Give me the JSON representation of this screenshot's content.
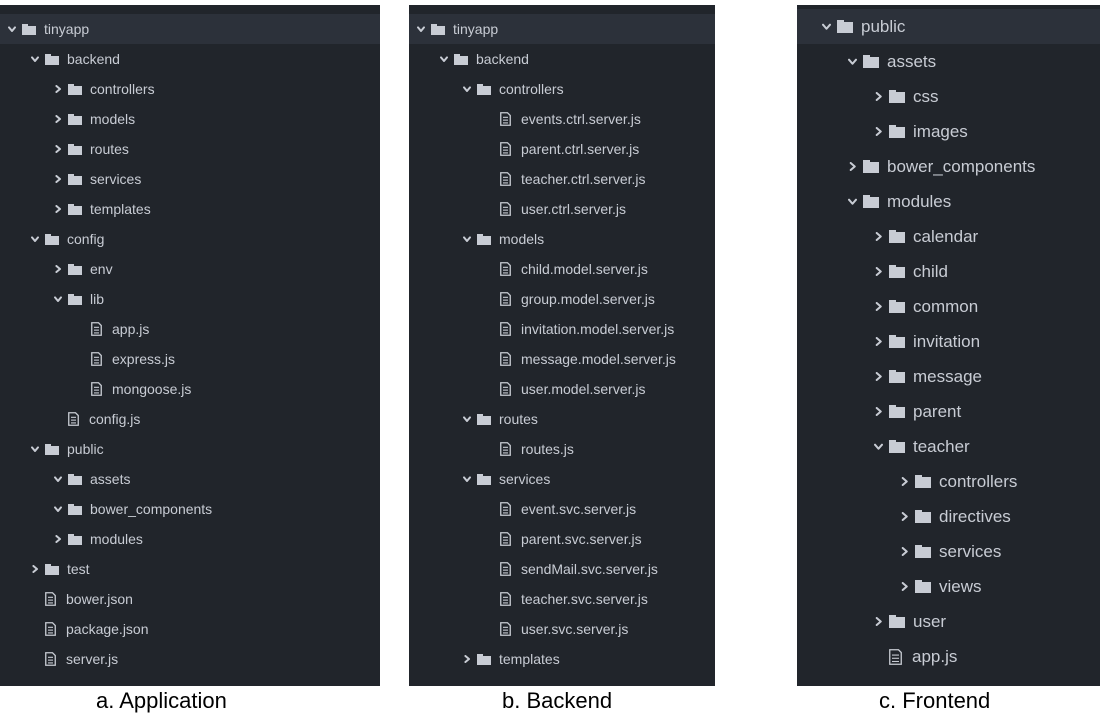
{
  "colors": {
    "panel_bg": "#21252b",
    "root_bg": "#2c313a",
    "text": "#c8ccd4"
  },
  "panels": [
    {
      "id": "a",
      "caption": "a.  Application",
      "items": [
        {
          "depth": 0,
          "type": "folder",
          "state": "open",
          "label": "tinyapp",
          "root": true
        },
        {
          "depth": 1,
          "type": "folder",
          "state": "open",
          "label": "backend"
        },
        {
          "depth": 2,
          "type": "folder",
          "state": "closed",
          "label": "controllers"
        },
        {
          "depth": 2,
          "type": "folder",
          "state": "closed",
          "label": "models"
        },
        {
          "depth": 2,
          "type": "folder",
          "state": "closed",
          "label": "routes"
        },
        {
          "depth": 2,
          "type": "folder",
          "state": "closed",
          "label": "services"
        },
        {
          "depth": 2,
          "type": "folder",
          "state": "closed",
          "label": "templates"
        },
        {
          "depth": 1,
          "type": "folder",
          "state": "open",
          "label": "config"
        },
        {
          "depth": 2,
          "type": "folder",
          "state": "closed",
          "label": "env"
        },
        {
          "depth": 2,
          "type": "folder",
          "state": "open",
          "label": "lib"
        },
        {
          "depth": 3,
          "type": "file",
          "label": "app.js"
        },
        {
          "depth": 3,
          "type": "file",
          "label": "express.js"
        },
        {
          "depth": 3,
          "type": "file",
          "label": "mongoose.js"
        },
        {
          "depth": 2,
          "type": "file",
          "label": "config.js"
        },
        {
          "depth": 1,
          "type": "folder",
          "state": "open",
          "label": "public"
        },
        {
          "depth": 2,
          "type": "folder",
          "state": "open",
          "label": "assets"
        },
        {
          "depth": 2,
          "type": "folder",
          "state": "open",
          "label": "bower_components"
        },
        {
          "depth": 2,
          "type": "folder",
          "state": "closed",
          "label": "modules"
        },
        {
          "depth": 1,
          "type": "folder",
          "state": "closed",
          "label": "test"
        },
        {
          "depth": 1,
          "type": "file",
          "label": "bower.json"
        },
        {
          "depth": 1,
          "type": "file",
          "label": "package.json"
        },
        {
          "depth": 1,
          "type": "file",
          "label": "server.js"
        }
      ]
    },
    {
      "id": "b",
      "caption": "b. Backend",
      "items": [
        {
          "depth": 0,
          "type": "folder",
          "state": "open",
          "label": "tinyapp",
          "root": true
        },
        {
          "depth": 1,
          "type": "folder",
          "state": "open",
          "label": "backend"
        },
        {
          "depth": 2,
          "type": "folder",
          "state": "open",
          "label": "controllers"
        },
        {
          "depth": 3,
          "type": "file",
          "label": "events.ctrl.server.js"
        },
        {
          "depth": 3,
          "type": "file",
          "label": "parent.ctrl.server.js"
        },
        {
          "depth": 3,
          "type": "file",
          "label": "teacher.ctrl.server.js"
        },
        {
          "depth": 3,
          "type": "file",
          "label": "user.ctrl.server.js"
        },
        {
          "depth": 2,
          "type": "folder",
          "state": "open",
          "label": "models"
        },
        {
          "depth": 3,
          "type": "file",
          "label": "child.model.server.js"
        },
        {
          "depth": 3,
          "type": "file",
          "label": "group.model.server.js"
        },
        {
          "depth": 3,
          "type": "file",
          "label": "invitation.model.server.js"
        },
        {
          "depth": 3,
          "type": "file",
          "label": "message.model.server.js"
        },
        {
          "depth": 3,
          "type": "file",
          "label": "user.model.server.js"
        },
        {
          "depth": 2,
          "type": "folder",
          "state": "open",
          "label": "routes"
        },
        {
          "depth": 3,
          "type": "file",
          "label": "routes.js"
        },
        {
          "depth": 2,
          "type": "folder",
          "state": "open",
          "label": "services"
        },
        {
          "depth": 3,
          "type": "file",
          "label": "event.svc.server.js"
        },
        {
          "depth": 3,
          "type": "file",
          "label": "parent.svc.server.js"
        },
        {
          "depth": 3,
          "type": "file",
          "label": "sendMail.svc.server.js"
        },
        {
          "depth": 3,
          "type": "file",
          "label": "teacher.svc.server.js"
        },
        {
          "depth": 3,
          "type": "file",
          "label": "user.svc.server.js"
        },
        {
          "depth": 2,
          "type": "folder",
          "state": "closed",
          "label": "templates"
        }
      ]
    },
    {
      "id": "c",
      "caption": "c. Frontend",
      "items": [
        {
          "depth": 0,
          "type": "folder",
          "state": "open",
          "label": "public",
          "root": true
        },
        {
          "depth": 1,
          "type": "folder",
          "state": "open",
          "label": "assets"
        },
        {
          "depth": 2,
          "type": "folder",
          "state": "closed",
          "label": "css"
        },
        {
          "depth": 2,
          "type": "folder",
          "state": "closed",
          "label": "images"
        },
        {
          "depth": 1,
          "type": "folder",
          "state": "closed",
          "label": "bower_components"
        },
        {
          "depth": 1,
          "type": "folder",
          "state": "open",
          "label": "modules"
        },
        {
          "depth": 2,
          "type": "folder",
          "state": "closed",
          "label": "calendar"
        },
        {
          "depth": 2,
          "type": "folder",
          "state": "closed",
          "label": "child"
        },
        {
          "depth": 2,
          "type": "folder",
          "state": "closed",
          "label": "common"
        },
        {
          "depth": 2,
          "type": "folder",
          "state": "closed",
          "label": "invitation"
        },
        {
          "depth": 2,
          "type": "folder",
          "state": "closed",
          "label": "message"
        },
        {
          "depth": 2,
          "type": "folder",
          "state": "closed",
          "label": "parent"
        },
        {
          "depth": 2,
          "type": "folder",
          "state": "open",
          "label": "teacher"
        },
        {
          "depth": 3,
          "type": "folder",
          "state": "closed",
          "label": "controllers"
        },
        {
          "depth": 3,
          "type": "folder",
          "state": "closed",
          "label": "directives"
        },
        {
          "depth": 3,
          "type": "folder",
          "state": "closed",
          "label": "services"
        },
        {
          "depth": 3,
          "type": "folder",
          "state": "closed",
          "label": "views"
        },
        {
          "depth": 2,
          "type": "folder",
          "state": "closed",
          "label": "user"
        },
        {
          "depth": 2,
          "type": "file",
          "label": "app.js"
        }
      ]
    }
  ]
}
